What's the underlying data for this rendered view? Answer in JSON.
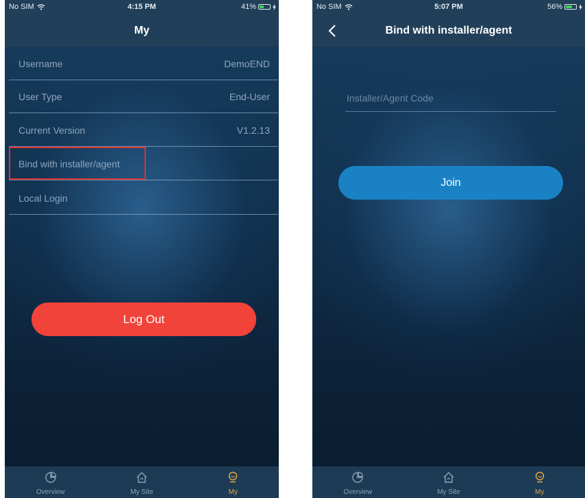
{
  "left_screen": {
    "status": {
      "carrier": "No SIM",
      "time": "4:15 PM",
      "battery": "41%",
      "battery_level": 0.41
    },
    "nav_title": "My",
    "rows": [
      {
        "label": "Username",
        "value": "DemoEND"
      },
      {
        "label": "User Type",
        "value": "End-User"
      },
      {
        "label": "Current Version",
        "value": "V1.2.13"
      },
      {
        "label": "Bind with installer/agent",
        "value": ""
      },
      {
        "label": "Local Login",
        "value": ""
      }
    ],
    "logout_label": "Log Out"
  },
  "right_screen": {
    "status": {
      "carrier": "No SIM",
      "time": "5:07 PM",
      "battery": "56%",
      "battery_level": 0.56
    },
    "nav_title": "Bind with installer/agent",
    "code_placeholder": "Installer/Agent Code",
    "join_label": "Join"
  },
  "tabs": [
    {
      "label": "Overview",
      "icon": "pie-chart-icon"
    },
    {
      "label": "My Site",
      "icon": "home-icon"
    },
    {
      "label": "My",
      "icon": "user-badge-icon"
    }
  ],
  "colors": {
    "accent": "#1a82c4",
    "logout": "#f2433a",
    "active_tab": "#e5a53b",
    "highlight_border": "#e0312e"
  }
}
